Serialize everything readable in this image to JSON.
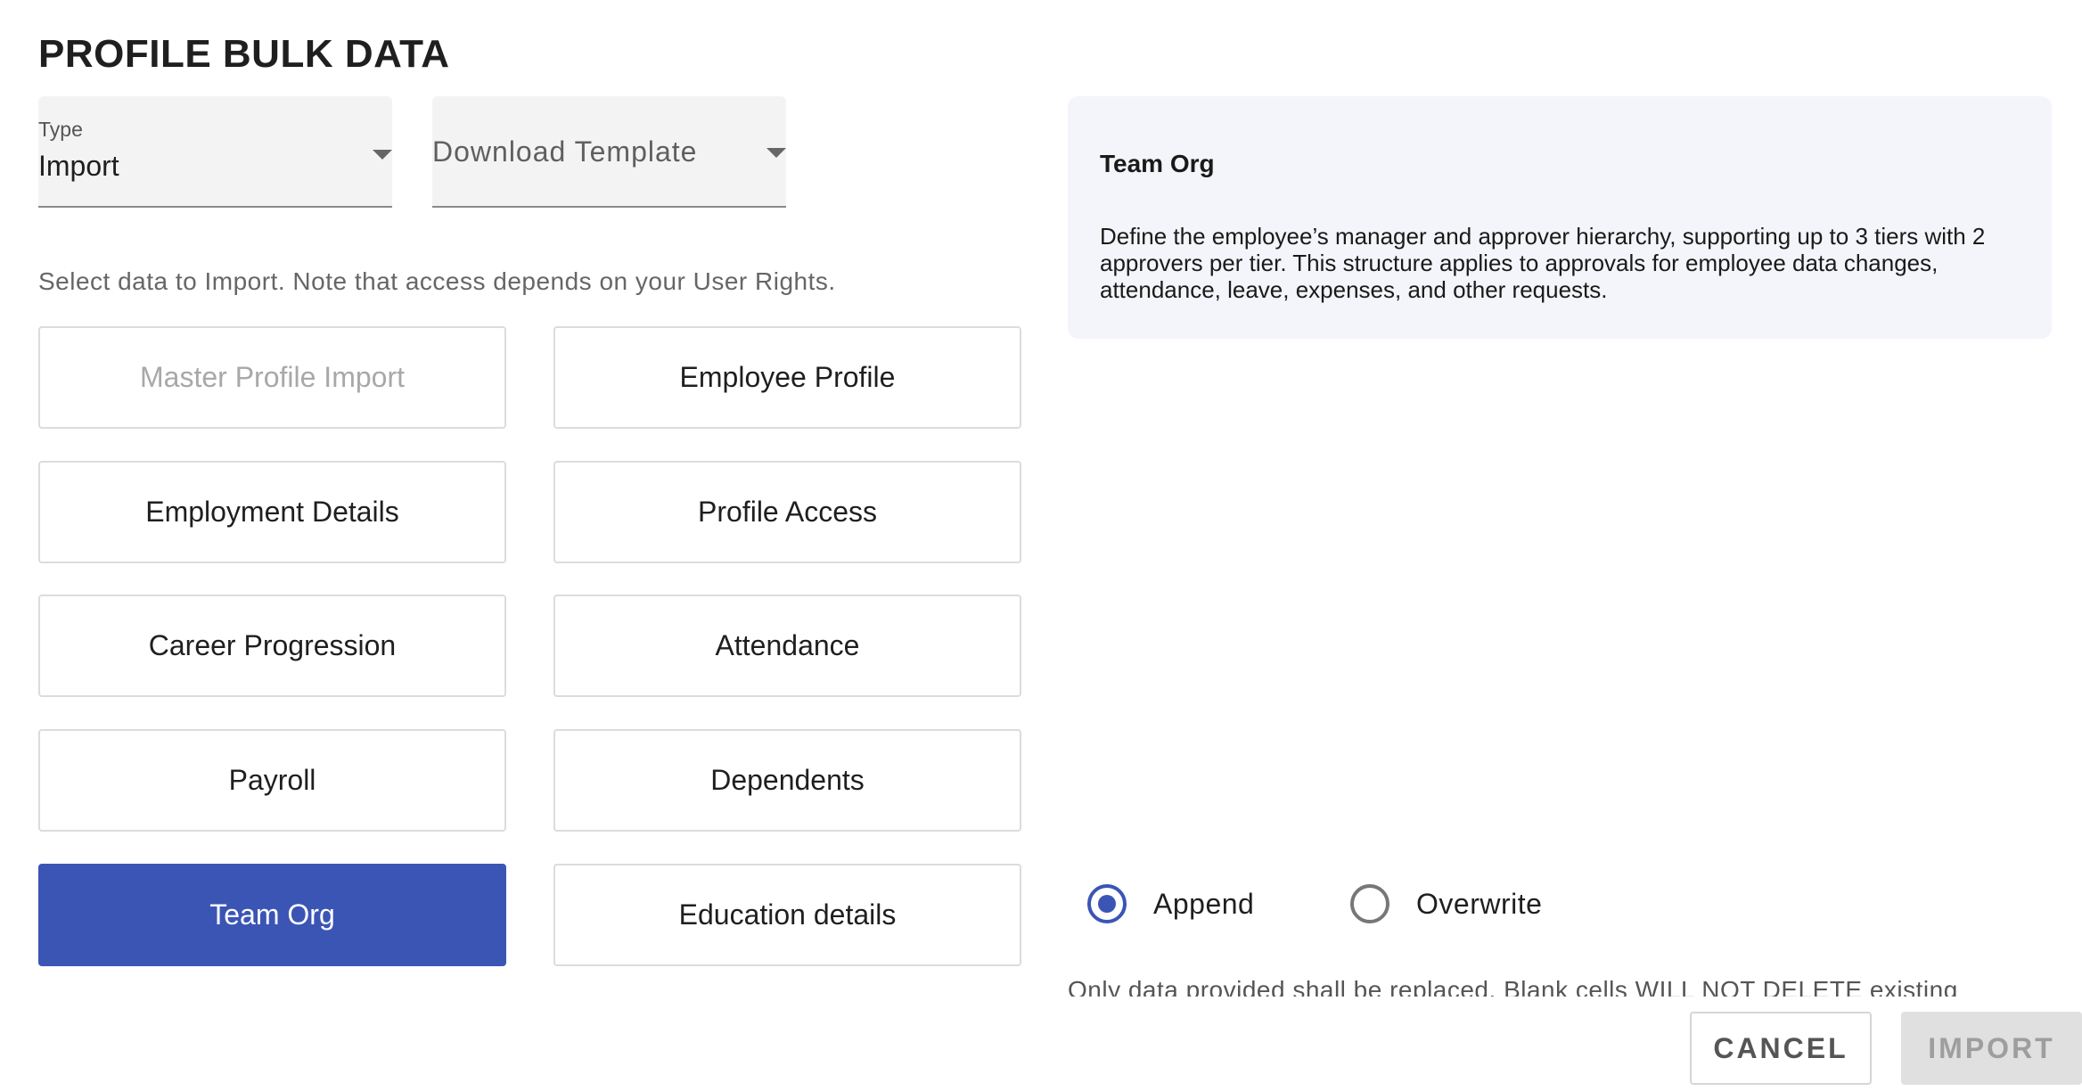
{
  "page": {
    "title": "PROFILE BULK DATA"
  },
  "type_select": {
    "label": "Type",
    "value": "Import"
  },
  "template_select": {
    "placeholder": "Download Template"
  },
  "hint": "Select data to Import. Note that access depends on your User Rights.",
  "options": [
    {
      "label": "Master Profile Import",
      "state": "disabled"
    },
    {
      "label": "Employee Profile",
      "state": "normal"
    },
    {
      "label": "Employment Details",
      "state": "normal"
    },
    {
      "label": "Profile Access",
      "state": "normal"
    },
    {
      "label": "Career Progression",
      "state": "normal"
    },
    {
      "label": "Attendance",
      "state": "normal"
    },
    {
      "label": "Payroll",
      "state": "normal"
    },
    {
      "label": "Dependents",
      "state": "normal"
    },
    {
      "label": "Team Org",
      "state": "selected"
    },
    {
      "label": "Education details",
      "state": "normal"
    }
  ],
  "info": {
    "title": "Team Org",
    "description": "Define the employee’s manager and approver hierarchy, supporting up to 3 tiers with 2 approvers per tier. This structure applies to approvals for employee data changes, attendance, leave, expenses, and other requests."
  },
  "mode": {
    "append_label": "Append",
    "overwrite_label": "Overwrite",
    "selected": "Append"
  },
  "mode_note": "Only data provided shall be replaced. Blank cells WILL NOT DELETE existing",
  "footer": {
    "cancel_label": "CANCEL",
    "import_label": "IMPORT"
  },
  "colors": {
    "accent": "#3b55b5",
    "info_bg": "#f4f5fa",
    "disabled_btn_bg": "#e0e0e0"
  }
}
